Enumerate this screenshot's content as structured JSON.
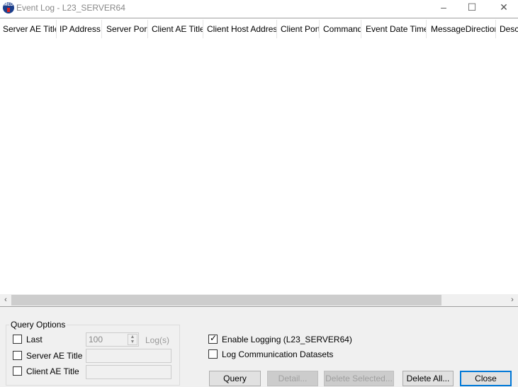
{
  "window": {
    "title": "Event Log - L23_SERVER64",
    "icon": "app-logo-icon",
    "minimize": "–",
    "maximize": "☐",
    "close": "✕"
  },
  "list": {
    "columns": [
      "Server AE Title",
      "IP Address",
      "Server Port",
      "Client AE Title",
      "Client Host Address",
      "Client Port",
      "Command",
      "Event Date Time",
      "MessageDirection",
      "Desc"
    ],
    "rows": []
  },
  "scrollbar": {
    "left": "‹",
    "right": "›"
  },
  "query_options": {
    "label": "Query Options",
    "last_label": "Last",
    "last_checked": false,
    "last_value": "100",
    "logs_label": "Log(s)",
    "server_ae_label": "Server AE Title",
    "server_ae_checked": false,
    "server_ae_value": "",
    "client_ae_label": "Client AE Title",
    "client_ae_checked": false,
    "client_ae_value": ""
  },
  "logging": {
    "enable_label": "Enable Logging (L23_SERVER64)",
    "enable_checked": true,
    "datasets_label": "Log Communication Datasets",
    "datasets_checked": false
  },
  "buttons": {
    "query": "Query",
    "detail": "Detail...",
    "delete_selected": "Delete Selected...",
    "delete_all": "Delete All...",
    "close": "Close"
  },
  "colors": {
    "accent": "#0078d7"
  }
}
